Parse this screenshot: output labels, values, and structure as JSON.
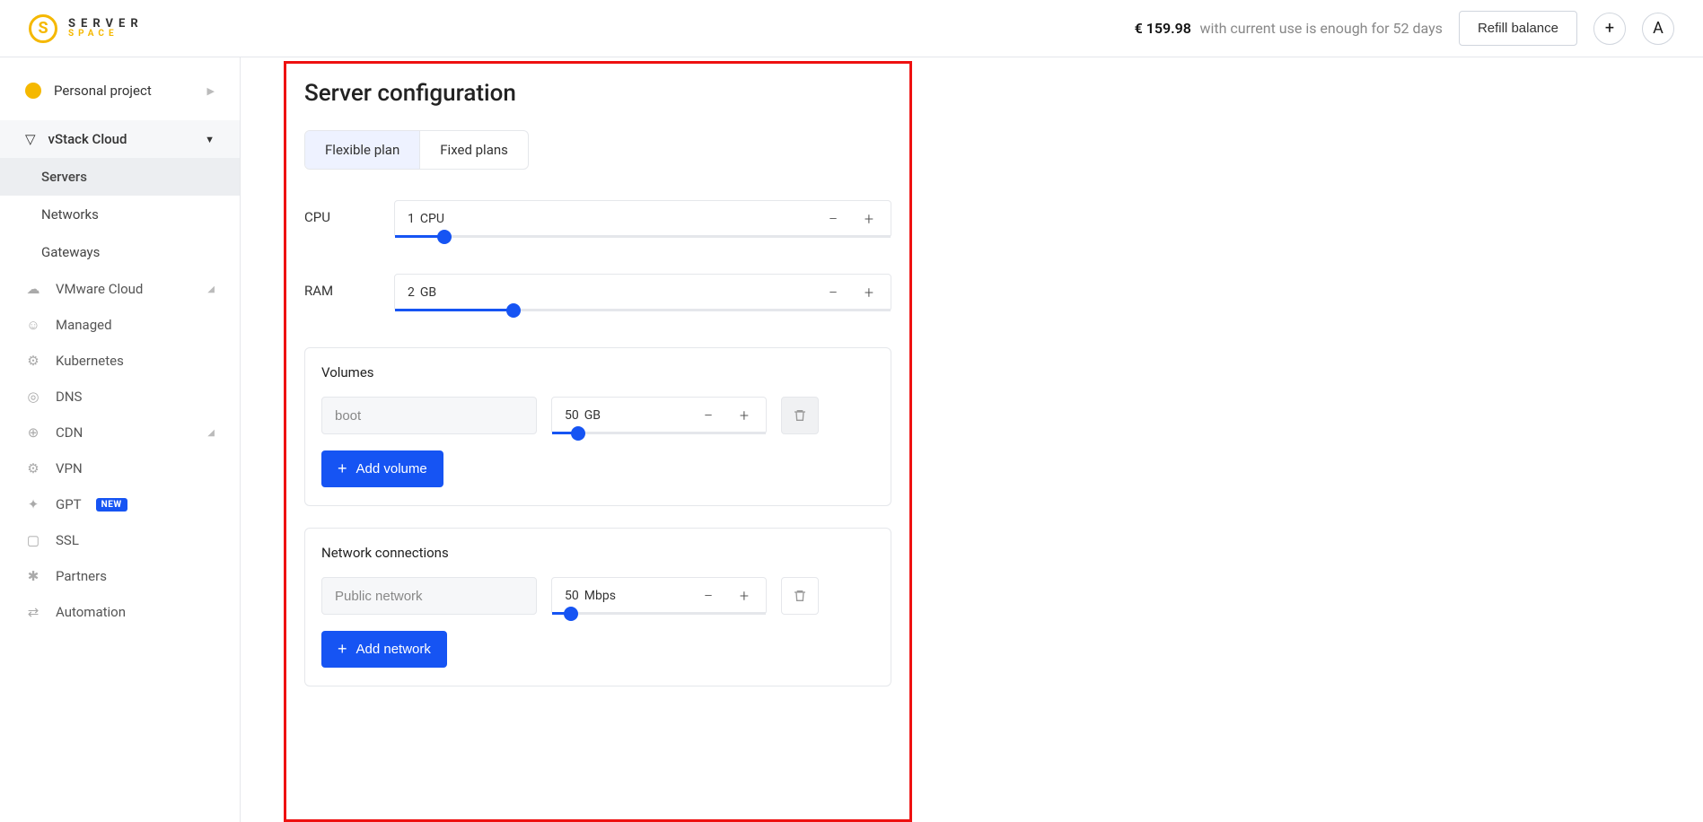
{
  "header": {
    "logo_top": "SERVER",
    "logo_bot": "SPACE",
    "balance_amount": "€ 159.98",
    "balance_note": "with current use is enough for 52 days",
    "refill_label": "Refill balance",
    "avatar_letter": "A"
  },
  "sidebar": {
    "project": "Personal project",
    "section": "vStack Cloud",
    "sub": {
      "servers": "Servers",
      "networks": "Networks",
      "gateways": "Gateways"
    },
    "items": {
      "vmware": "VMware Cloud",
      "managed": "Managed",
      "kubernetes": "Kubernetes",
      "dns": "DNS",
      "cdn": "CDN",
      "vpn": "VPN",
      "gpt": "GPT",
      "gpt_badge": "NEW",
      "ssl": "SSL",
      "partners": "Partners",
      "automation": "Automation"
    }
  },
  "main": {
    "title": "Server configuration",
    "tabs": {
      "flexible": "Flexible plan",
      "fixed": "Fixed plans"
    },
    "cpu": {
      "label": "CPU",
      "value": "1",
      "unit": "CPU",
      "fill_pct": 10
    },
    "ram": {
      "label": "RAM",
      "value": "2",
      "unit": "GB",
      "fill_pct": 24
    },
    "volumes": {
      "title": "Volumes",
      "row": {
        "name": "boot",
        "value": "50",
        "unit": "GB",
        "fill_pct": 12
      },
      "add_label": "Add volume"
    },
    "network": {
      "title": "Network connections",
      "row": {
        "name": "Public network",
        "value": "50",
        "unit": "Mbps",
        "fill_pct": 9
      },
      "add_label": "Add network"
    }
  }
}
